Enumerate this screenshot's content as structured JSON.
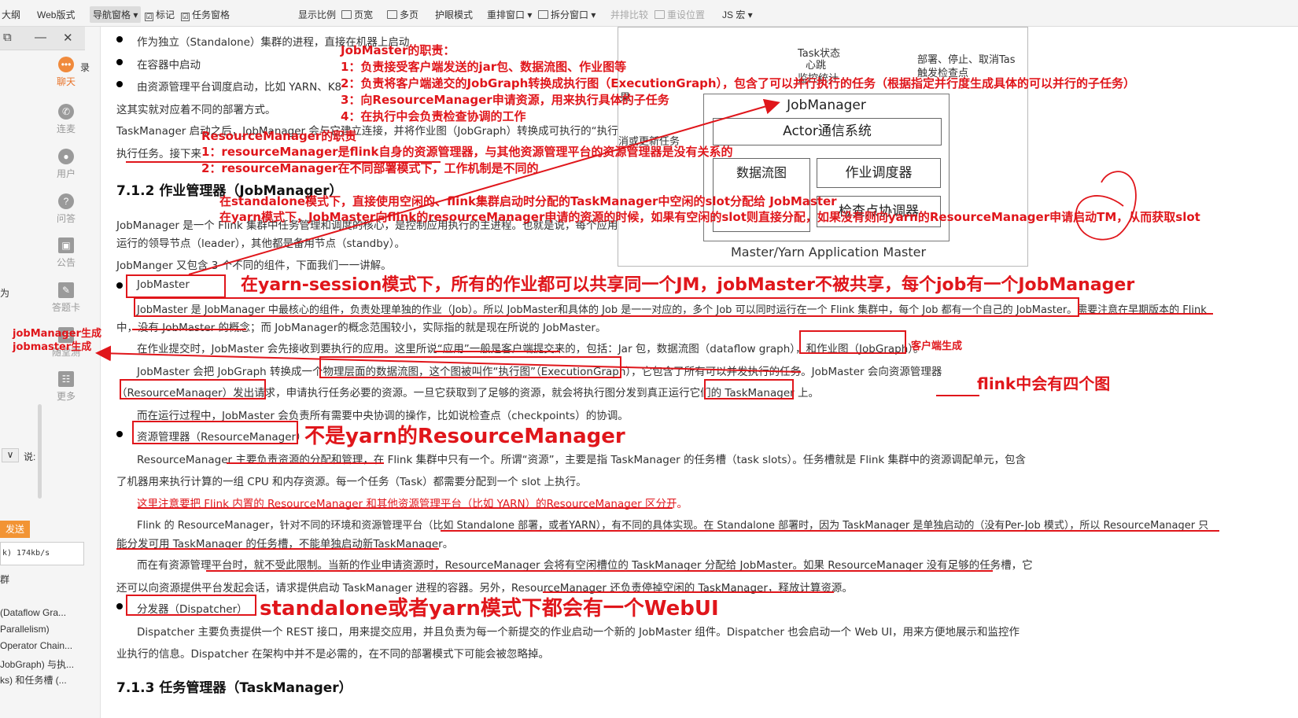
{
  "toolbar": {
    "items": [
      "大纲",
      "Web版式",
      "导航窗格",
      "标记",
      "任务窗格",
      "显示比例",
      "页宽",
      "多页",
      "护眼模式",
      "重排窗口",
      "拆分窗口",
      "并排比较",
      "重设位置",
      "JS 宏"
    ],
    "checked": "☑"
  },
  "sidebar": {
    "nav": [
      "聊天",
      "连麦",
      "用户",
      "问答",
      "公告",
      "答题卡",
      "随堂测",
      "更多"
    ],
    "side_label_1": "录",
    "side_label_2": "为",
    "say_label": "说:",
    "send_button": "发送",
    "speed": "k) 174kb/s",
    "toc": [
      "群",
      "(Dataflow Gra...",
      "Parallelism)",
      "Operator Chain...",
      "JobGraph) 与执...",
      "ks) 和任务槽 (..."
    ]
  },
  "doc": {
    "lines": [
      "作为独立（Standalone）集群的进程，直接在机器上启动",
      "在容器中启动",
      "由资源管理平台调度启动，比如 YARN、K8",
      "这其实就对应着不同的部署方式。",
      "TaskManager 启动之后，JobManager 会与它建立连接，并将作业图（JobGraph）转换成可执行的“执行图”",
      "执行任务。接下来",
      "7.1.2  作业管理器（JobManager）",
      "JobManager 是一个 Flink 集群中任务管理和调度的核心，是控制应用执行的主进程。也就是说，每个应用都",
      "运行的领导节点（leader），其他都是备用节点（standby）。",
      "JobManger 又包含 3 个不同的组件，下面我们一一讲解。",
      "JobMaster",
      "JobMaster 是 JobManager 中最核心的组件，负责处理单独的作业（Job）。所以 JobMaster和具体的 Job 是一一对应的，多个 Job 可以同时运行在一个 Flink 集群中，每个 Job 都有一个自己的 JobMaster。需要注意在早期版本的 Flink",
      "中，没有 JobMaster 的概念；而 JobManager的概念范围较小，实际指的就是现在所说的 JobMaster。",
      "在作业提交时，JobMaster 会先接收到要执行的应用。这里所说“应用”一般是客户端提交来的，包括：Jar 包，数据流图（dataflow graph），和作业图（JobGraph）。",
      "JobMaster 会把 JobGraph 转换成一个物理层面的数据流图，这个图被叫作“执行图”（ExecutionGraph），它包含了所有可以并发执行的任务。JobMaster 会向资源管理器",
      "（ResourceManager）发出请求，申请执行任务必要的资源。一旦它获取到了足够的资源，就会将执行图分发到真正运行它们的 TaskManager 上。",
      "而在运行过程中，JobMaster 会负责所有需要中央协调的操作，比如说检查点（checkpoints）的协调。",
      "资源管理器（ResourceManager）",
      "ResourceManager 主要负责资源的分配和管理，在 Flink 集群中只有一个。所谓“资源”，主要是指 TaskManager 的任务槽（task slots）。任务槽就是 Flink 集群中的资源调配单元，包含",
      "了机器用来执行计算的一组 CPU 和内存资源。每一个任务（Task）都需要分配到一个 slot 上执行。",
      "这里注意要把 Flink 内置的 ResourceManager 和其他资源管理平台（比如 YARN）的ResourceManager 区分开。",
      "Flink 的 ResourceManager，针对不同的环境和资源管理平台（比如 Standalone 部署，或者YARN），有不同的具体实现。在 Standalone 部署时，因为 TaskManager 是单独启动的（没有Per-Job 模式），所以 ResourceManager 只",
      "能分发可用 TaskManager 的任务槽，不能单独启动新TaskManager。",
      "而在有资源管理平台时，就不受此限制。当新的作业申请资源时，ResourceManager 会将有空闲槽位的 TaskManager 分配给 JobMaster。如果 ResourceManager 没有足够的任务槽，它",
      "还可以向资源提供平台发起会话，请求提供启动 TaskManager 进程的容器。另外，ResourceManager 还负责停掉空闲的 TaskManager，释放计算资源。",
      "分发器（Dispatcher）",
      "Dispatcher 主要负责提供一个 REST 接口，用来提交应用，并且负责为每一个新提交的作业启动一个新的 JobMaster 组件。Dispatcher 也会启动一个 Web UI，用来方便地展示和监控作",
      "业执行的信息。Dispatcher 在架构中并不是必需的，在不同的部署模式下可能会被忽略掉。",
      "7.1.3  任务管理器（TaskManager）"
    ]
  },
  "diagram": {
    "top_text": "Task状态",
    "heartbeat": "心跳",
    "stats": "监控统计",
    "deploy": "部署、停止、取消Tas",
    "trigger": "触发检查点",
    "left_1": "果",
    "left_2": "消或更新任务",
    "jobmanager": "JobManager",
    "actor": "Actor通信系统",
    "dataflow": "数据流图",
    "scheduler": "作业调度器",
    "checkpoint": "检查点协调器",
    "master": "Master/Yarn Application Master"
  },
  "notes": {
    "jm_title": "JobMaster的职责：",
    "jm_1": "1：负责接受客户端发送的jar包、数据流图、作业图等",
    "jm_2": "2：负责将客户端递交的JobGraph转换成执行图（ExecutionGraph），包含了可以并行执行的任务（根据指定并行度生成具体的可以并行的子任务）",
    "jm_3": "3：向ResourceManager申请资源，用来执行具体的子任务",
    "jm_4": "4：在执行中会负责检查协调的工作",
    "rm_title": "ResourceManager的职责",
    "rm_1": "1：resourceManager是flink自身的资源管理器，与其他资源管理平台的资源管理器是没有关系的",
    "rm_2": "2：resourceManager在不同部署模式下，工作机制是不同的",
    "standalone": "在standalone模式下，直接使用空闲的、flink集群启动时分配的TaskManager中空闲的slot分配给  JobMaster",
    "yarn": "在yarn模式下，JobMaster向flink的resourceManager申请的资源的时候，如果有空闲的slot则直接分配，如果没有则向yarn的ResourceManager申请启动TM，从而获取slot",
    "session": "在yarn-session模式下，所有的作业都可以共享同一个JM，jobMaster不被共享，每个job有一个JobManager",
    "left_note_1": "jobManager生成",
    "left_note_2": "jobmaster生成",
    "client": "客户端生成",
    "four_graphs": "flink中会有四个图",
    "not_yarn": "不是yarn的ResourceManager",
    "webui": "standalone或者yarn模式下都会有一个WebUI"
  }
}
